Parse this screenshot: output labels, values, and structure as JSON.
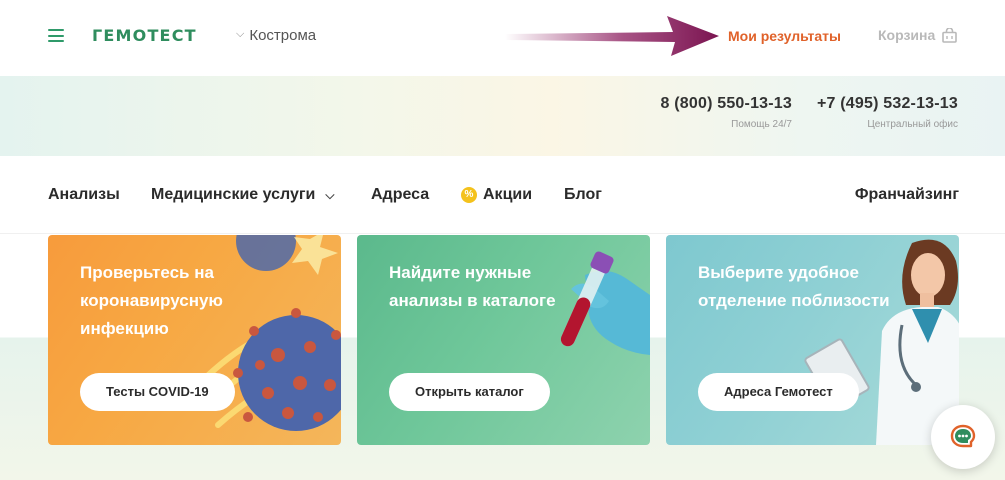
{
  "header": {
    "logo": "ГЕМОТЕСТ",
    "city": "Кострома",
    "my_results": "Мои результаты",
    "cart": "Корзина"
  },
  "phones": [
    {
      "number": "8 (800) 550-13-13",
      "caption": "Помощь 24/7"
    },
    {
      "number": "+7 (495) 532-13-13",
      "caption": "Центральный офис"
    }
  ],
  "nav": {
    "analyses": "Анализы",
    "medical_services": "Медицинские услуги",
    "addresses": "Адреса",
    "promotions": "Акции",
    "blog": "Блог",
    "franchising": "Франчайзинг"
  },
  "cards": [
    {
      "title": "Проверьтесь на коронавирусную инфекцию",
      "button": "Тесты COVID-19"
    },
    {
      "title": "Найдите нужные анализы в каталоге",
      "button": "Открыть каталог"
    },
    {
      "title": "Выберите удобное отделение поблизости",
      "button": "Адреса Гемотест"
    }
  ],
  "colors": {
    "brand_green": "#2f8d5e",
    "accent_orange": "#e0622a",
    "annotation_arrow": "#8a1a5c"
  },
  "icons": {
    "menu": "burger-menu-icon",
    "city": "chevron-down-icon",
    "cart": "shopping-bag-icon",
    "promo": "percent-badge-icon",
    "chat": "chat-bubble-icon"
  }
}
